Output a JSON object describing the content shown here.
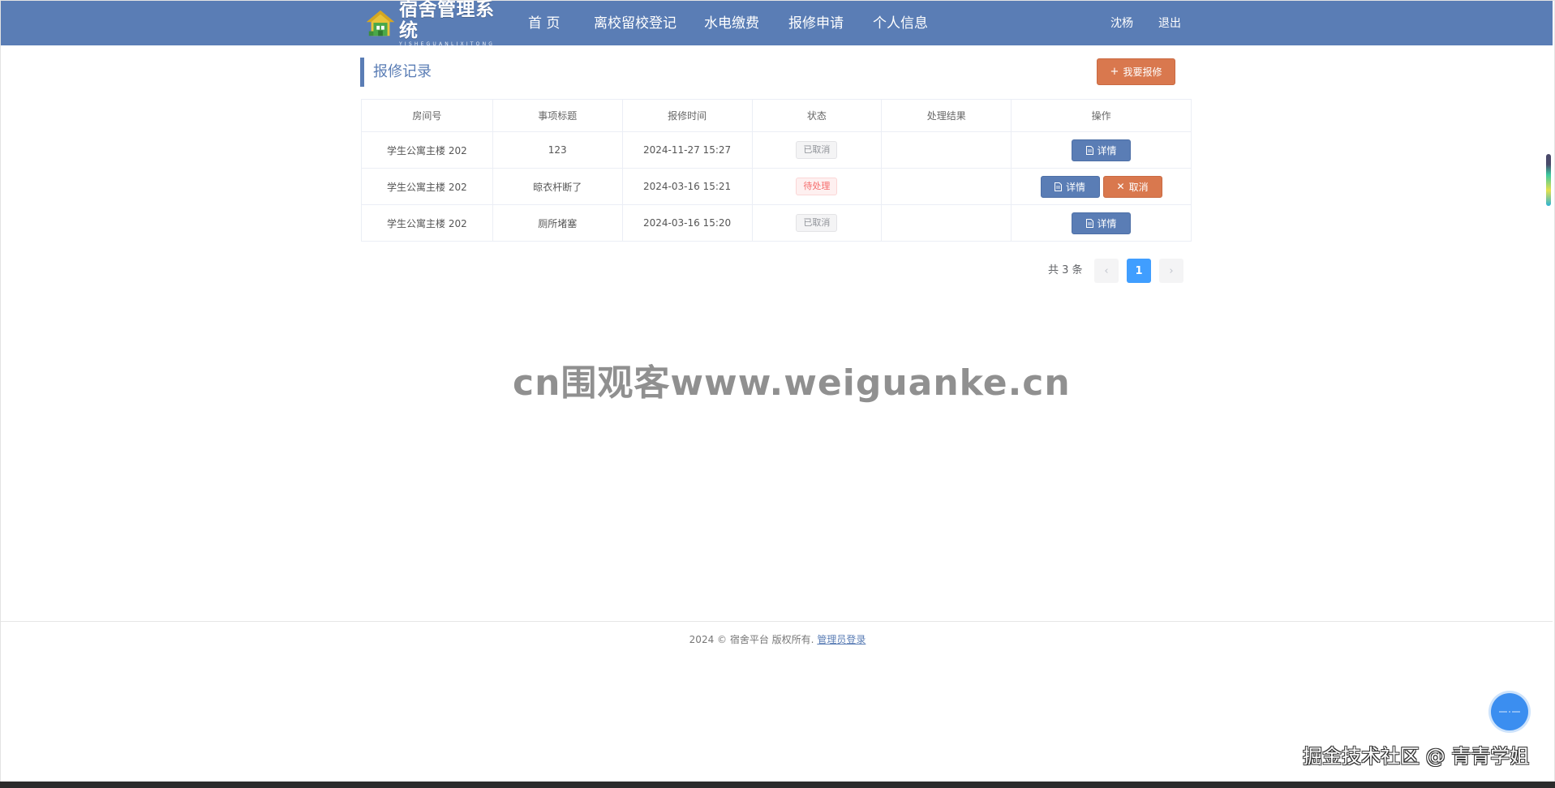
{
  "navbar": {
    "logo_title": "宿舍管理系统",
    "logo_sub": "YISHEGUANLIXITONG",
    "items": [
      {
        "label": "首 页"
      },
      {
        "label": "离校留校登记"
      },
      {
        "label": "水电缴费"
      },
      {
        "label": "报修申请"
      },
      {
        "label": "个人信息"
      }
    ],
    "user": "沈杨",
    "logout": "退出"
  },
  "section": {
    "title": "报修记录",
    "report_button": "我要报修"
  },
  "table": {
    "headers": [
      "房间号",
      "事项标题",
      "报修时间",
      "状态",
      "处理结果",
      "操作"
    ],
    "rows": [
      {
        "room": "学生公寓主楼 202",
        "title": "123",
        "time": "2024-11-27 15:27",
        "status": "已取消",
        "result": "",
        "detail": "详情"
      },
      {
        "room": "学生公寓主楼 202",
        "title": "晾衣杆断了",
        "time": "2024-03-16 15:21",
        "status": "待处理",
        "result": "",
        "detail": "详情",
        "cancel": "取消"
      },
      {
        "room": "学生公寓主楼 202",
        "title": "厕所堵塞",
        "time": "2024-03-16 15:20",
        "status": "已取消",
        "result": "",
        "detail": "详情"
      }
    ]
  },
  "pagination": {
    "total": "共 3 条",
    "current": "1",
    "prev": "‹",
    "next": "›"
  },
  "watermark": "cn围观客www.weiguanke.cn",
  "footer": {
    "text": "2024 © 宿舍平台 版权所有.",
    "admin_link": "管理员登录"
  },
  "community_watermark": "掘金技术社区 @ 青青学姐",
  "colors": {
    "primary": "#5a7db5",
    "accent": "#d9784e",
    "active_page": "#409eff"
  }
}
